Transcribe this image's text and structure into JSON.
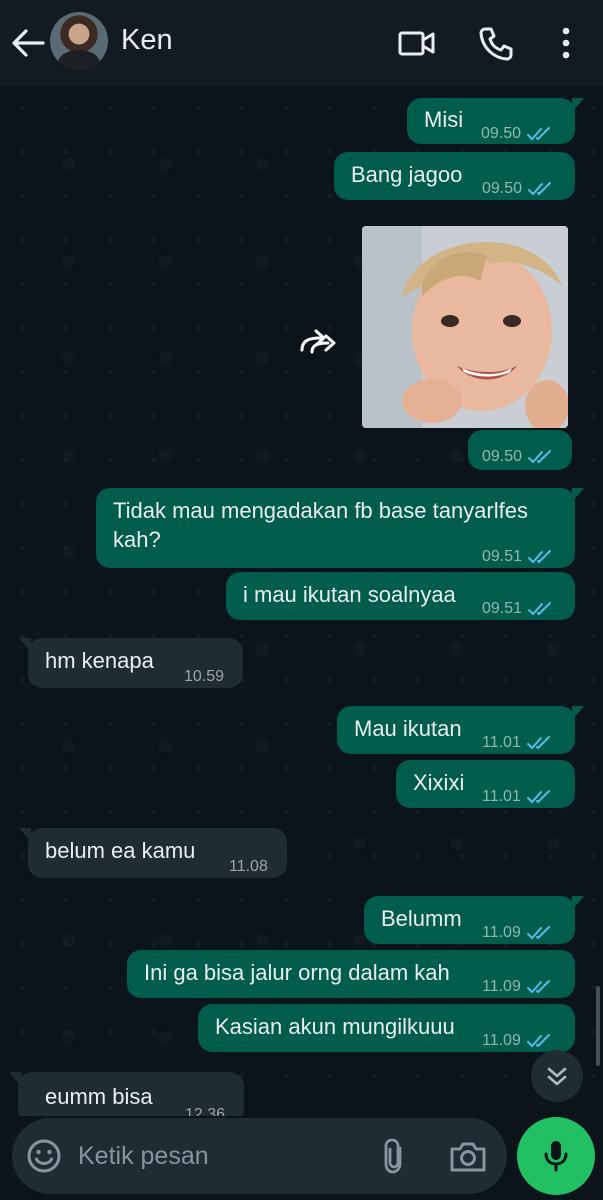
{
  "header": {
    "contact_name": "Ken",
    "icons": [
      "back-arrow-icon",
      "video-call-icon",
      "phone-icon",
      "more-vert-icon"
    ]
  },
  "messages": [
    {
      "dir": "out",
      "text": "Misi",
      "time": "09.50",
      "status": "read"
    },
    {
      "dir": "out",
      "text": "Bang jagoo",
      "time": "09.50",
      "status": "read"
    },
    {
      "dir": "out",
      "type": "image",
      "text": "",
      "time": "09.50",
      "status": "read",
      "forward_icon": "forward-icon"
    },
    {
      "dir": "out",
      "text": "Tidak mau mengadakan fb base tanyarlfes",
      "text_line2": "kah?",
      "time": "09.51",
      "status": "read"
    },
    {
      "dir": "out",
      "text": "i mau ikutan soalnyaa",
      "time": "09.51",
      "status": "read"
    },
    {
      "dir": "in",
      "text": "hm kenapa",
      "time": "10.59"
    },
    {
      "dir": "out",
      "text": "Mau ikutan",
      "time": "11.01",
      "status": "read"
    },
    {
      "dir": "out",
      "text": "Xixixi",
      "time": "11.01",
      "status": "read"
    },
    {
      "dir": "in",
      "text": "belum ea kamu",
      "time": "11.08"
    },
    {
      "dir": "out",
      "text": "Belumm",
      "time": "11.09",
      "status": "read"
    },
    {
      "dir": "out",
      "text": "Ini ga bisa jalur orng dalam kah",
      "time": "11.09",
      "status": "read"
    },
    {
      "dir": "out",
      "text": "Kasian akun mungilkuuu",
      "time": "11.09",
      "status": "read"
    },
    {
      "dir": "in",
      "text": "eumm bisa",
      "time": "12.36"
    }
  ],
  "composer": {
    "placeholder": "Ketik pesan",
    "value": ""
  },
  "colors": {
    "background": "#0b141a",
    "header": "#111b21",
    "outgoing_bubble": "#005c4b",
    "incoming_bubble": "#202c33",
    "read_ticks": "#53bdeb",
    "mic_button": "#21c063"
  }
}
